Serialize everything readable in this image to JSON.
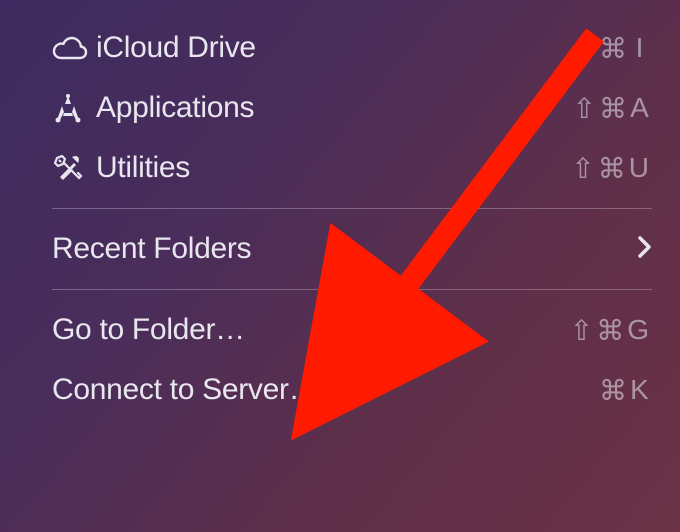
{
  "menu": {
    "section1": [
      {
        "label": "iCloud Drive",
        "icon": "cloud-icon",
        "shortcut": [
          "⇧",
          "⌘",
          "I"
        ]
      },
      {
        "label": "Applications",
        "icon": "applications-icon",
        "shortcut": [
          "⇧",
          "⌘",
          "A"
        ]
      },
      {
        "label": "Utilities",
        "icon": "utilities-icon",
        "shortcut": [
          "⇧",
          "⌘",
          "U"
        ]
      }
    ],
    "section2": [
      {
        "label": "Recent Folders",
        "submenu": true
      }
    ],
    "section3": [
      {
        "label": "Go to Folder…",
        "shortcut": [
          "⇧",
          "⌘",
          "G"
        ]
      },
      {
        "label": "Connect to Server…",
        "shortcut": [
          "⌘",
          "K"
        ]
      }
    ]
  },
  "annotation": {
    "arrow_color": "#ff1a00"
  }
}
